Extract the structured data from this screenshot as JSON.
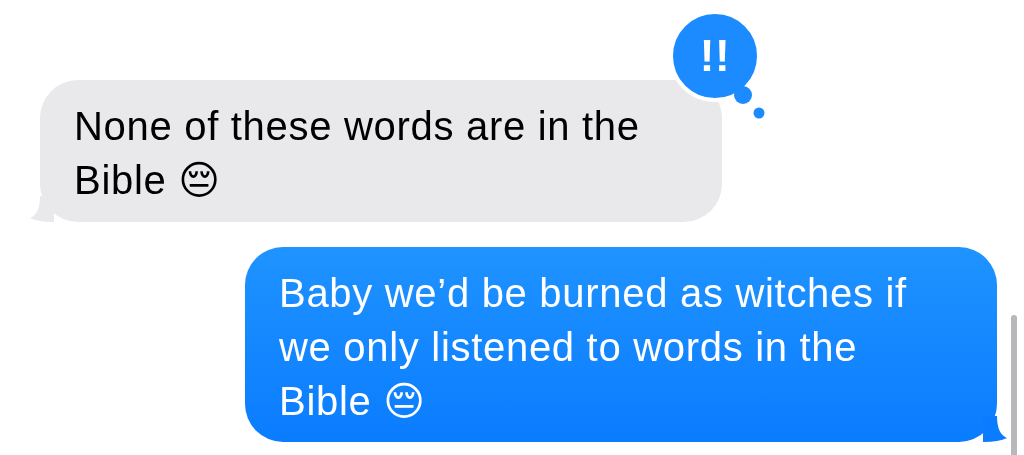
{
  "messages": [
    {
      "kind": "received",
      "text": "None of these words are in the Bible 😔",
      "reaction": "!!"
    },
    {
      "kind": "sent",
      "text": "Baby we’d be burned as witches if we only listened to words in the Bible 😔"
    }
  ]
}
